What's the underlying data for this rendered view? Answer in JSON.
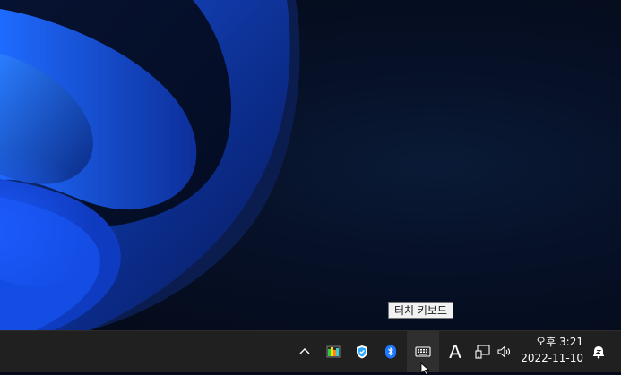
{
  "tooltip": {
    "text": "터치 키보드"
  },
  "tray": {
    "overflow_icon": "chevron-up-icon",
    "apps": [
      "color-chart-app-icon",
      "shield-security-icon",
      "bluetooth-icon"
    ],
    "touch_keyboard_icon": "keyboard-icon",
    "ime_indicator": "A",
    "network_icon": "network-icon",
    "volume_icon": "volume-icon",
    "notification_icon": "notification-bell-icon"
  },
  "clock": {
    "time": "오후 3:21",
    "date": "2022-11-10"
  },
  "colors": {
    "taskbar": "#202020",
    "desktop_bg": "#050b18",
    "accent": "#0a5eea",
    "tooltip_bg": "#f2f2f2"
  }
}
